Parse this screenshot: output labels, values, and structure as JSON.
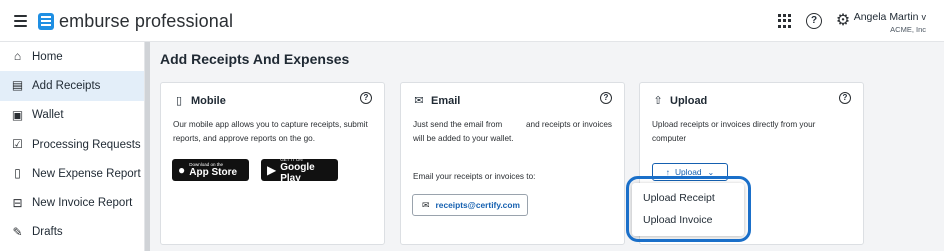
{
  "header": {
    "brand": "emburse professional",
    "user_name": "Angela Martin",
    "user_chevron": "v",
    "org": "ACME, Inc"
  },
  "sidebar": {
    "items": [
      {
        "label": "Home",
        "icon": "home-icon"
      },
      {
        "label": "Add Receipts",
        "icon": "receipt-icon",
        "active": true
      },
      {
        "label": "Wallet",
        "icon": "wallet-icon"
      },
      {
        "label": "Processing Requests",
        "icon": "checkbox-icon"
      },
      {
        "label": "New Expense Report",
        "icon": "document-icon"
      },
      {
        "label": "New Invoice Report",
        "icon": "invoice-icon"
      },
      {
        "label": "Drafts",
        "icon": "pencil-icon"
      }
    ]
  },
  "main": {
    "title": "Add Receipts And Expenses",
    "mobile": {
      "title": "Mobile",
      "text": "Our mobile app allows you to capture receipts, submit reports, and approve reports on the go.",
      "appstore_small": "Download on the",
      "appstore_big": "App Store",
      "googleplay_small": "GET IT ON",
      "googleplay_big": "Google Play"
    },
    "email": {
      "title": "Email",
      "text_1": "Just send the email from",
      "text_2": "and receipts or invoices",
      "text_3": "will be added to your wallet.",
      "text_4": "Email your receipts or invoices to:",
      "address": "receipts@certify.com"
    },
    "upload": {
      "title": "Upload",
      "text": "Upload receipts or invoices directly from your computer",
      "button_label": "Upload",
      "menu": [
        "Upload Receipt",
        "Upload Invoice"
      ]
    }
  },
  "colors": {
    "brand_blue": "#1f8fe3",
    "link_blue": "#1560b0",
    "active_bg": "#e3eef9",
    "highlight": "#1a6fc9"
  }
}
